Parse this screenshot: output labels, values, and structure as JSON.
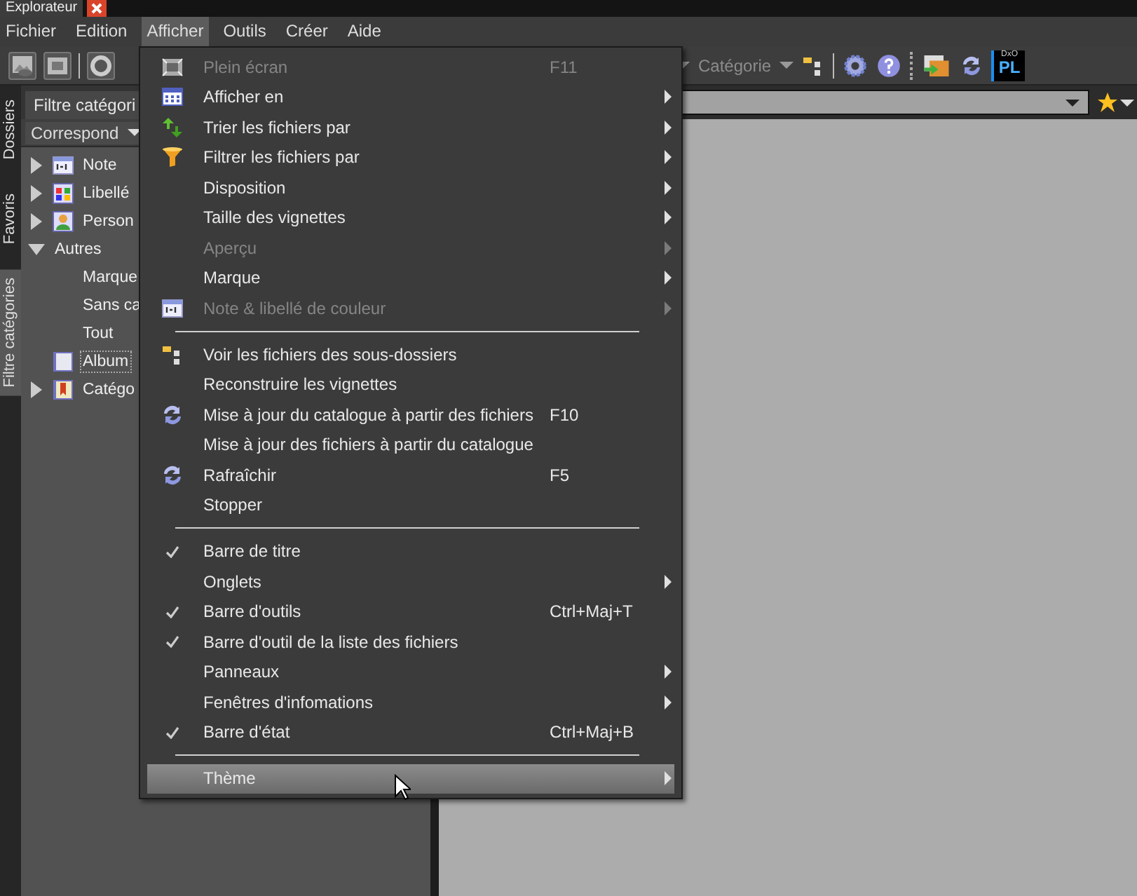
{
  "window": {
    "title": "Explorateur"
  },
  "menu_bar": [
    {
      "label": "Fichier",
      "selected": false
    },
    {
      "label": "Edition",
      "selected": false
    },
    {
      "label": "Afficher",
      "selected": true
    },
    {
      "label": "Outils",
      "selected": false
    },
    {
      "label": "Créer",
      "selected": false
    },
    {
      "label": "Aide",
      "selected": false
    }
  ],
  "toolbar": {
    "category_label": "Catégorie",
    "logo_top": "DxO",
    "logo_text": "PL"
  },
  "side_tabs": [
    {
      "label": "Dossiers",
      "selected": false
    },
    {
      "label": "Favoris",
      "selected": false
    },
    {
      "label": "Filtre catégories",
      "selected": true
    }
  ],
  "panel": {
    "tab": "Filtre catégori",
    "match_mode": "Correspond",
    "tree": [
      {
        "label": "Note",
        "kind": "note",
        "expanded": false,
        "selected": false
      },
      {
        "label": "Libellé",
        "kind": "labels",
        "expanded": false,
        "selected": false
      },
      {
        "label": "Person",
        "kind": "person",
        "expanded": false,
        "selected": false
      },
      {
        "label": "Autres",
        "kind": "plain",
        "expanded": true,
        "selected": false,
        "children": [
          {
            "label": "Marque",
            "selected": false
          },
          {
            "label": "Sans ca",
            "selected": false
          },
          {
            "label": "Tout",
            "selected": false
          }
        ]
      },
      {
        "label": "Album",
        "kind": "album",
        "selected": true
      },
      {
        "label": "Catégo",
        "kind": "category",
        "expanded": false,
        "selected": false
      }
    ]
  },
  "dropdown_menu": [
    {
      "kind": "item",
      "label": "Plein écran",
      "shortcut": "F11",
      "submenu": false,
      "disabled": true,
      "checked": false,
      "selected": false
    },
    {
      "kind": "item",
      "label": "Afficher en",
      "submenu": true,
      "disabled": false,
      "checked": false,
      "selected": false
    },
    {
      "kind": "item",
      "label": "Trier les fichiers par",
      "submenu": true,
      "disabled": false,
      "checked": false,
      "selected": false
    },
    {
      "kind": "item",
      "label": "Filtrer les fichiers par",
      "submenu": true,
      "disabled": false,
      "checked": false,
      "selected": false
    },
    {
      "kind": "item",
      "label": "Disposition",
      "submenu": true,
      "disabled": false,
      "checked": false,
      "selected": false
    },
    {
      "kind": "item",
      "label": "Taille des vignettes",
      "submenu": true,
      "disabled": false,
      "checked": false,
      "selected": false
    },
    {
      "kind": "item",
      "label": "Aperçu",
      "submenu": true,
      "disabled": true,
      "checked": false,
      "selected": false
    },
    {
      "kind": "item",
      "label": "Marque",
      "submenu": true,
      "disabled": false,
      "checked": false,
      "selected": false
    },
    {
      "kind": "item",
      "label": "Note & libellé de couleur",
      "submenu": true,
      "disabled": true,
      "checked": false,
      "selected": false
    },
    {
      "kind": "separator"
    },
    {
      "kind": "item",
      "label": "Voir les fichiers des sous-dossiers",
      "submenu": false,
      "disabled": false,
      "checked": false,
      "selected": false
    },
    {
      "kind": "item",
      "label": "Reconstruire les vignettes",
      "submenu": false,
      "disabled": false,
      "checked": false,
      "selected": false
    },
    {
      "kind": "item",
      "label": "Mise à jour du catalogue à partir des fichiers",
      "shortcut": "F10",
      "submenu": false,
      "disabled": false,
      "checked": false,
      "selected": false
    },
    {
      "kind": "item",
      "label": "Mise à jour des fichiers à partir du catalogue",
      "submenu": false,
      "disabled": false,
      "checked": false,
      "selected": false
    },
    {
      "kind": "item",
      "label": "Rafraîchir",
      "shortcut": "F5",
      "submenu": false,
      "disabled": false,
      "checked": false,
      "selected": false
    },
    {
      "kind": "item",
      "label": "Stopper",
      "submenu": false,
      "disabled": false,
      "checked": false,
      "selected": false
    },
    {
      "kind": "separator"
    },
    {
      "kind": "item",
      "label": "Barre de titre",
      "submenu": false,
      "disabled": false,
      "checked": true,
      "selected": false
    },
    {
      "kind": "item",
      "label": "Onglets",
      "submenu": true,
      "disabled": false,
      "checked": false,
      "selected": false
    },
    {
      "kind": "item",
      "label": "Barre d'outils",
      "shortcut": "Ctrl+Maj+T",
      "submenu": false,
      "disabled": false,
      "checked": true,
      "selected": false
    },
    {
      "kind": "item",
      "label": "Barre d'outil de la liste des fichiers",
      "submenu": false,
      "disabled": false,
      "checked": true,
      "selected": false
    },
    {
      "kind": "item",
      "label": "Panneaux",
      "submenu": true,
      "disabled": false,
      "checked": false,
      "selected": false
    },
    {
      "kind": "item",
      "label": "Fenêtres d'infomations",
      "submenu": true,
      "disabled": false,
      "checked": false,
      "selected": false
    },
    {
      "kind": "item",
      "label": "Barre d'état",
      "shortcut": "Ctrl+Maj+B",
      "submenu": false,
      "disabled": false,
      "checked": true,
      "selected": false
    },
    {
      "kind": "separator"
    },
    {
      "kind": "item",
      "label": "Thème",
      "submenu": true,
      "disabled": false,
      "checked": false,
      "selected": true
    }
  ]
}
